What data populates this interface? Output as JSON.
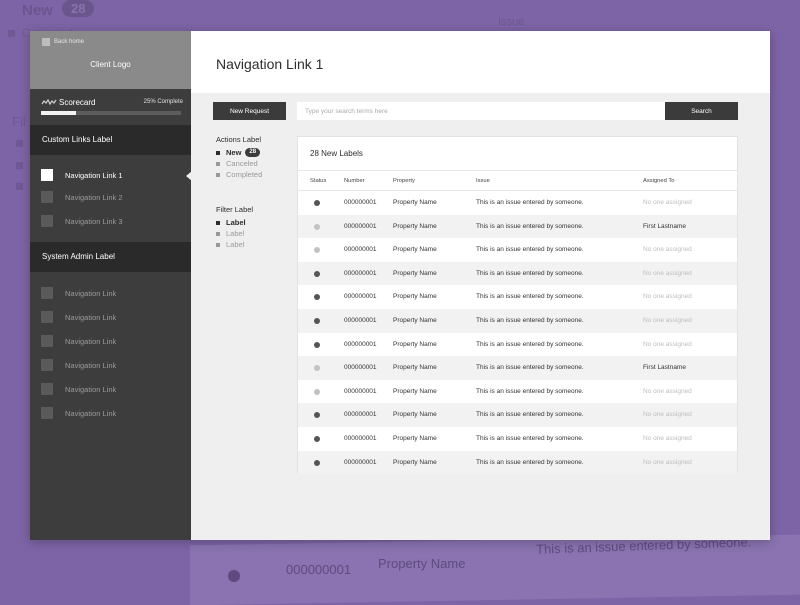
{
  "background": {
    "new_label": "New",
    "new_count": "28",
    "canceled_label": "Canceled",
    "issue_header": "Issue",
    "filter_fragment": "Fil",
    "row_number": "000000001",
    "row_property": "Property Name",
    "row_issue": "This is an issue entered by someone."
  },
  "sidebar": {
    "back_home": "Back home",
    "client_logo": "Client Logo",
    "scorecard_label": "Scorecard",
    "scorecard_percent": "25% Complete",
    "progress_fraction": 0.25,
    "custom_section_label": "Custom Links Label",
    "custom_links": [
      {
        "label": "Navigation Link 1",
        "active": true
      },
      {
        "label": "Navigation Link 2",
        "active": false
      },
      {
        "label": "Navigation Link 3",
        "active": false
      }
    ],
    "admin_section_label": "System Admin Label",
    "admin_links": [
      {
        "label": "Navigation Link"
      },
      {
        "label": "Navigation Link"
      },
      {
        "label": "Navigation Link"
      },
      {
        "label": "Navigation Link"
      },
      {
        "label": "Navigation Link"
      },
      {
        "label": "Navigation Link"
      }
    ]
  },
  "header": {
    "title": "Navigation Link 1"
  },
  "toolbar": {
    "new_request_label": "New Request",
    "search_placeholder": "Type your search terms here",
    "search_label": "Search"
  },
  "filters": {
    "actions_label": "Actions Label",
    "actions": [
      {
        "label": "New",
        "count": "28",
        "selected": true
      },
      {
        "label": "Canceled",
        "selected": false
      },
      {
        "label": "Completed",
        "selected": false
      }
    ],
    "filter_label": "Filter Label",
    "filter_items": [
      {
        "label": "Label",
        "selected": true
      },
      {
        "label": "Label",
        "selected": false
      },
      {
        "label": "Label",
        "selected": false
      }
    ]
  },
  "table": {
    "title": "28 New Labels",
    "columns": [
      "Status",
      "Number",
      "Property",
      "Issue",
      "Assigned To"
    ],
    "status_colors": {
      "dark": "#555555",
      "light": "#c2c2c2"
    },
    "rows": [
      {
        "status": "dark",
        "number": "000000001",
        "property": "Property Name",
        "issue": "This is an issue entered by someone.",
        "assigned": "No one assigned",
        "assigned_muted": true
      },
      {
        "status": "light",
        "number": "000000001",
        "property": "Property Name",
        "issue": "This is an issue entered by someone.",
        "assigned": "First Lastname",
        "assigned_muted": false
      },
      {
        "status": "light",
        "number": "000000001",
        "property": "Property Name",
        "issue": "This is an issue entered by someone.",
        "assigned": "No one assigned",
        "assigned_muted": true
      },
      {
        "status": "dark",
        "number": "000000001",
        "property": "Property Name",
        "issue": "This is an issue entered by someone.",
        "assigned": "No one assigned",
        "assigned_muted": true
      },
      {
        "status": "dark",
        "number": "000000001",
        "property": "Property Name",
        "issue": "This is an issue entered by someone.",
        "assigned": "No one assigned",
        "assigned_muted": true
      },
      {
        "status": "dark",
        "number": "000000001",
        "property": "Property Name",
        "issue": "This is an issue entered by someone.",
        "assigned": "No one assigned",
        "assigned_muted": true
      },
      {
        "status": "dark",
        "number": "000000001",
        "property": "Property Name",
        "issue": "This is an issue entered by someone.",
        "assigned": "No one assigned",
        "assigned_muted": true
      },
      {
        "status": "light",
        "number": "000000001",
        "property": "Property Name",
        "issue": "This is an issue entered by someone.",
        "assigned": "First Lastname",
        "assigned_muted": false
      },
      {
        "status": "light",
        "number": "000000001",
        "property": "Property Name",
        "issue": "This is an issue entered by someone.",
        "assigned": "No one assigned",
        "assigned_muted": true
      },
      {
        "status": "dark",
        "number": "000000001",
        "property": "Property Name",
        "issue": "This is an issue entered by someone.",
        "assigned": "No one assigned",
        "assigned_muted": true
      },
      {
        "status": "dark",
        "number": "000000001",
        "property": "Property Name",
        "issue": "This is an issue entered by someone.",
        "assigned": "No one assigned",
        "assigned_muted": true
      },
      {
        "status": "dark",
        "number": "000000001",
        "property": "Property Name",
        "issue": "This is an issue entered by someone.",
        "assigned": "No one assigned",
        "assigned_muted": true
      }
    ]
  }
}
